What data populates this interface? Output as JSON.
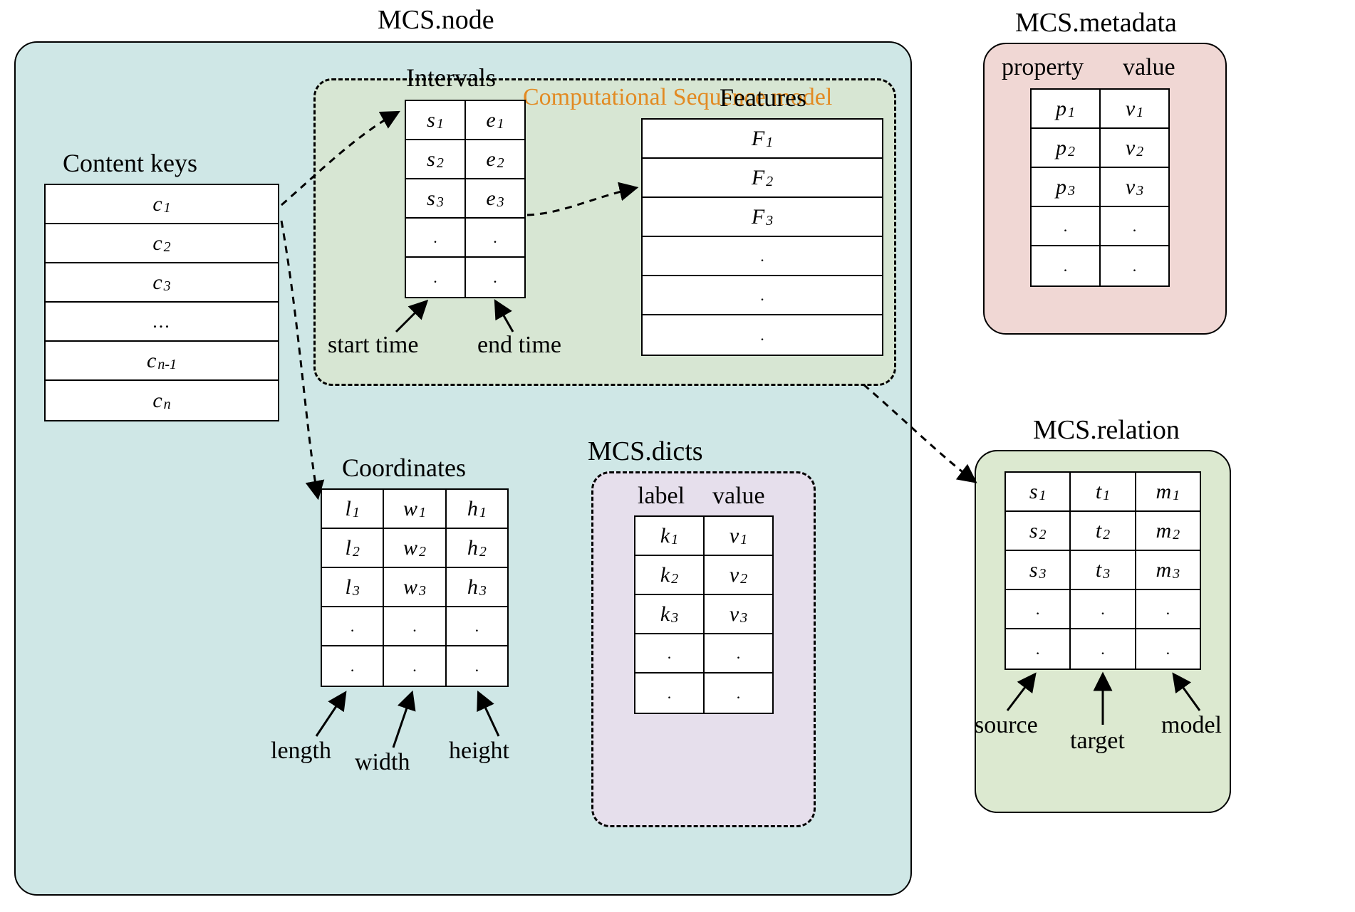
{
  "titles": {
    "node": "MCS.node",
    "metadata": "MCS.metadata",
    "dicts": "MCS.dicts",
    "relation": "MCS.relation",
    "content_keys": "Content keys",
    "intervals": "Intervals",
    "features": "Features",
    "coordinates": "Coordinates",
    "csm": "Computational Sequence model",
    "meta_prop": "property",
    "meta_val": "value",
    "dicts_label": "label",
    "dicts_value": "value"
  },
  "footers": {
    "start_time": "start time",
    "end_time": "end time",
    "length": "length",
    "width": "width",
    "height": "height",
    "source": "source",
    "target": "target",
    "model": "model"
  },
  "content_keys": [
    [
      {
        "v": "c",
        "s": "1"
      }
    ],
    [
      {
        "v": "c",
        "s": "2"
      }
    ],
    [
      {
        "v": "c",
        "s": "3"
      }
    ],
    "ellipsis",
    [
      {
        "v": "c",
        "s": "n-1"
      }
    ],
    [
      {
        "v": "c",
        "s": "n"
      }
    ]
  ],
  "intervals": [
    [
      {
        "v": "s",
        "s": "1"
      },
      {
        "v": "e",
        "s": "1"
      }
    ],
    [
      {
        "v": "s",
        "s": "2"
      },
      {
        "v": "e",
        "s": "2"
      }
    ],
    [
      {
        "v": "s",
        "s": "3"
      },
      {
        "v": "e",
        "s": "3"
      }
    ],
    "dots2",
    "dots2"
  ],
  "features": [
    [
      {
        "v": "F",
        "s": "1"
      }
    ],
    [
      {
        "v": "F",
        "s": "2"
      }
    ],
    [
      {
        "v": "F",
        "s": "3"
      }
    ],
    "dots1",
    "dots1",
    "dots1"
  ],
  "coordinates": [
    [
      {
        "v": "l",
        "s": "1"
      },
      {
        "v": "w",
        "s": "1"
      },
      {
        "v": "h",
        "s": "1"
      }
    ],
    [
      {
        "v": "l",
        "s": "2"
      },
      {
        "v": "w",
        "s": "2"
      },
      {
        "v": "h",
        "s": "2"
      }
    ],
    [
      {
        "v": "l",
        "s": "3"
      },
      {
        "v": "w",
        "s": "3"
      },
      {
        "v": "h",
        "s": "3"
      }
    ],
    "dots3",
    "dots3"
  ],
  "dicts": [
    [
      {
        "v": "k",
        "s": "1"
      },
      {
        "v": "v",
        "s": "1"
      }
    ],
    [
      {
        "v": "k",
        "s": "2"
      },
      {
        "v": "v",
        "s": "2"
      }
    ],
    [
      {
        "v": "k",
        "s": "3"
      },
      {
        "v": "v",
        "s": "3"
      }
    ],
    "dots2",
    "dots2"
  ],
  "metadata": [
    [
      {
        "v": "p",
        "s": "1"
      },
      {
        "v": "v",
        "s": "1"
      }
    ],
    [
      {
        "v": "p",
        "s": "2"
      },
      {
        "v": "v",
        "s": "2"
      }
    ],
    [
      {
        "v": "p",
        "s": "3"
      },
      {
        "v": "v",
        "s": "3"
      }
    ],
    "dots2",
    "dots2"
  ],
  "relation": [
    [
      {
        "v": "s",
        "s": "1"
      },
      {
        "v": "t",
        "s": "1"
      },
      {
        "v": "m",
        "s": "1"
      }
    ],
    [
      {
        "v": "s",
        "s": "2"
      },
      {
        "v": "t",
        "s": "2"
      },
      {
        "v": "m",
        "s": "2"
      }
    ],
    [
      {
        "v": "s",
        "s": "3"
      },
      {
        "v": "t",
        "s": "3"
      },
      {
        "v": "m",
        "s": "3"
      }
    ],
    "dots3",
    "dots3"
  ]
}
